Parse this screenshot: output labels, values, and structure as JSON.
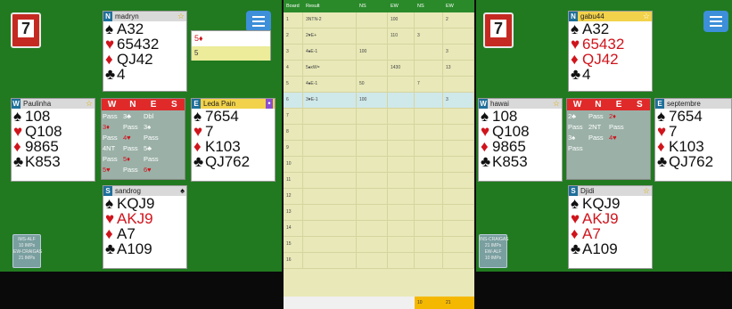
{
  "left": {
    "board_number": "7",
    "north": {
      "seat": "N",
      "name": "madryn",
      "spades": "A32",
      "hearts": "65432",
      "diamonds": "QJ42",
      "clubs": "4"
    },
    "west": {
      "seat": "W",
      "name": "Paulinha",
      "spades": "108",
      "hearts": "Q108",
      "diamonds": "9865",
      "clubs": "K853"
    },
    "east": {
      "seat": "E",
      "name": "Leda Pain",
      "spades": "7654",
      "hearts": "7",
      "diamonds": "K103",
      "clubs": "QJ762"
    },
    "south": {
      "seat": "S",
      "name": "sandrog",
      "spades": "KQJ9",
      "hearts": "AKJ9",
      "diamonds": "A7",
      "clubs": "A109"
    },
    "bidding": {
      "dirs": [
        "W",
        "N",
        "E",
        "S"
      ],
      "calls": [
        "Pass",
        "3♣",
        "Dbl",
        "3♦",
        "Pass",
        "3♠",
        "Pass",
        "4♥",
        "Pass",
        "4NT",
        "Pass",
        "5♣",
        "Pass",
        "5♦",
        "Pass",
        "5♥",
        "Pass",
        "6♥",
        "",
        ""
      ]
    },
    "bid_panel": {
      "row1": "5♦",
      "row2": "5"
    },
    "score_box": {
      "line1": "IMS-ALF",
      "line2": "10 IMPs",
      "line3": "EW-CRAIGAS",
      "line4": "21 IMPs"
    }
  },
  "table": {
    "headers": [
      "Board",
      "Result",
      "NS",
      "EW",
      "NS",
      "EW"
    ],
    "rows": [
      {
        "board": "1",
        "result": "3NTN-2",
        "ns": "",
        "ew": "100",
        "ns2": "",
        "ew2": "2"
      },
      {
        "board": "2",
        "result": "2♥E+",
        "ns": "",
        "ew": "110",
        "ns2": "3",
        "ew2": ""
      },
      {
        "board": "3",
        "result": "4♠E-1",
        "ns": "100",
        "ew": "",
        "ns2": "",
        "ew2": "3"
      },
      {
        "board": "4",
        "result": "5♠xW=",
        "ns": "",
        "ew": "1430",
        "ns2": "",
        "ew2": "13"
      },
      {
        "board": "5",
        "result": "4♠E-1",
        "ns": "50",
        "ew": "",
        "ns2": "7",
        "ew2": ""
      },
      {
        "board": "6",
        "result": "3♥E-1",
        "ns": "100",
        "ew": "",
        "ns2": "",
        "ew2": "3"
      },
      {
        "board": "7",
        "result": "",
        "ns": "",
        "ew": "",
        "ns2": "",
        "ew2": ""
      },
      {
        "board": "8",
        "result": "",
        "ns": "",
        "ew": "",
        "ns2": "",
        "ew2": ""
      },
      {
        "board": "9",
        "result": "",
        "ns": "",
        "ew": "",
        "ns2": "",
        "ew2": ""
      },
      {
        "board": "10",
        "result": "",
        "ns": "",
        "ew": "",
        "ns2": "",
        "ew2": ""
      },
      {
        "board": "11",
        "result": "",
        "ns": "",
        "ew": "",
        "ns2": "",
        "ew2": ""
      },
      {
        "board": "12",
        "result": "",
        "ns": "",
        "ew": "",
        "ns2": "",
        "ew2": ""
      },
      {
        "board": "13",
        "result": "",
        "ns": "",
        "ew": "",
        "ns2": "",
        "ew2": ""
      },
      {
        "board": "14",
        "result": "",
        "ns": "",
        "ew": "",
        "ns2": "",
        "ew2": ""
      },
      {
        "board": "15",
        "result": "",
        "ns": "",
        "ew": "",
        "ns2": "",
        "ew2": ""
      },
      {
        "board": "16",
        "result": "",
        "ns": "",
        "ew": "",
        "ns2": "",
        "ew2": ""
      }
    ],
    "totals": {
      "ns": "10",
      "ew": "21"
    }
  },
  "right": {
    "board_number": "7",
    "north": {
      "seat": "N",
      "name": "gabu44",
      "spades": "A32",
      "hearts": "65432",
      "diamonds": "QJ42",
      "clubs": "4"
    },
    "west": {
      "seat": "W",
      "name": "hawai",
      "spades": "108",
      "hearts": "Q108",
      "diamonds": "9865",
      "clubs": "K853"
    },
    "east": {
      "seat": "E",
      "name": "septembre",
      "spades": "7654",
      "hearts": "7",
      "diamonds": "K103",
      "clubs": "QJ762"
    },
    "south": {
      "seat": "S",
      "name": "Djidi",
      "spades": "KQJ9",
      "hearts": "AKJ9",
      "diamonds": "A7",
      "clubs": "A109"
    },
    "bidding": {
      "dirs": [
        "W",
        "N",
        "E",
        "S"
      ],
      "calls": [
        "",
        "",
        "",
        "2♣",
        "Pass",
        "2♦",
        "Pass",
        "2NT",
        "Pass",
        "3♠",
        "Pass",
        "4♥",
        "Pass",
        "",
        "",
        ""
      ]
    },
    "score_box": {
      "line1": "INS-CRAIGAS",
      "line2": "21 IMPs",
      "line3": "EW-ALF",
      "line4": "10 IMPs"
    }
  }
}
